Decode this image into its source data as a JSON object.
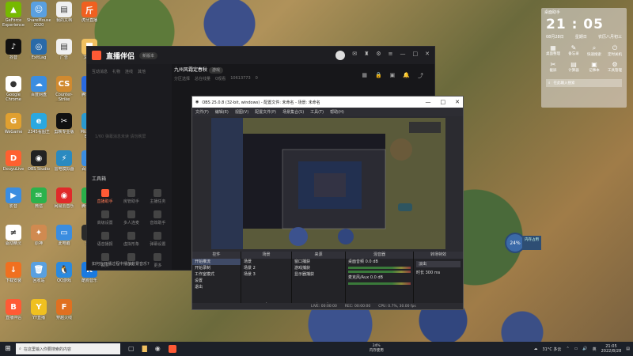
{
  "desktop_icons": [
    {
      "label": "GeForce Experience",
      "color": "#76b900",
      "glyph": "▲"
    },
    {
      "label": "抖音",
      "color": "#111",
      "glyph": "♪"
    },
    {
      "label": "Google Chrome",
      "color": "#fff",
      "glyph": "●"
    },
    {
      "label": "WeGame",
      "color": "#e0a030",
      "glyph": "G"
    },
    {
      "label": "DouyuLive",
      "color": "#ff6030",
      "glyph": "D"
    },
    {
      "label": "影音",
      "color": "#3b8de0",
      "glyph": "▶"
    },
    {
      "label": "驱动精灵",
      "color": "#fff",
      "glyph": "≠"
    },
    {
      "label": "下载安装",
      "color": "#f07020",
      "glyph": "↓"
    },
    {
      "label": "直播伴侣",
      "color": "#ff5a35",
      "glyph": "B"
    },
    {
      "label": "ShareMouse 2020",
      "color": "#5aa0e0",
      "glyph": "☺"
    },
    {
      "label": "ExitLag",
      "color": "#2a6aa8",
      "glyph": "◎"
    },
    {
      "label": "百度网盘",
      "color": "#3b8de0",
      "glyph": "☁"
    },
    {
      "label": "2345看图王",
      "color": "#2aa8e0",
      "glyph": "e"
    },
    {
      "label": "OBS Studio",
      "color": "#222",
      "glyph": "◉"
    },
    {
      "label": "微信",
      "color": "#2bb24c",
      "glyph": "✉"
    },
    {
      "label": "原神",
      "color": "#d08a50",
      "glyph": "✦"
    },
    {
      "label": "回收站",
      "color": "#5aa0e0",
      "glyph": "🗑"
    },
    {
      "label": "YY直播",
      "color": "#f0c020",
      "glyph": "Y"
    },
    {
      "label": "我的文档",
      "color": "#f0f0f0",
      "glyph": "▤"
    },
    {
      "label": "广告",
      "color": "#f0f0f0",
      "glyph": "▤"
    },
    {
      "label": "Counter-Strike Global...",
      "color": "#d08a30",
      "glyph": "CS"
    },
    {
      "label": "剪映专业版",
      "color": "#111",
      "glyph": "✂"
    },
    {
      "label": "雷电模拟器",
      "color": "#2a8ac0",
      "glyph": "⚡"
    },
    {
      "label": "网易云音乐",
      "color": "#e02a2a",
      "glyph": "◉"
    },
    {
      "label": "此电脑",
      "color": "#3b8de0",
      "glyph": "▭"
    },
    {
      "label": "QQ游戏",
      "color": "#2a8ae0",
      "glyph": "🐧"
    },
    {
      "label": "穿越火线",
      "color": "#e07020",
      "glyph": "F"
    },
    {
      "label": "虎牙直播",
      "color": "#f06020",
      "glyph": "斤"
    },
    {
      "label": "文件夹",
      "color": "#f0c060",
      "glyph": "▇"
    },
    {
      "label": "腾讯会议",
      "color": "#2a6ae0",
      "glyph": "▣"
    },
    {
      "label": "Microsoft Edge",
      "color": "#2a9ad0",
      "glyph": "e"
    },
    {
      "label": "百度网盘",
      "color": "#3b8de0",
      "glyph": "☁"
    },
    {
      "label": "腾讯视频",
      "color": "#2ab04a",
      "glyph": "▶"
    },
    {
      "label": "录屏",
      "color": "#2a2a2a",
      "glyph": "◉"
    },
    {
      "label": "酷狗音乐",
      "color": "#1a7ae0",
      "glyph": "K"
    }
  ],
  "stream_app": {
    "logo": "直播伴侣",
    "badge": "新版本",
    "tabs": [
      "互动消息",
      "礼物",
      "连线",
      "其他"
    ],
    "placeholder": "1/60 弹幕消息未读 请勿刷屏",
    "room_title": "九州风霜定春秋",
    "room_tag": "游戏",
    "room_meta": [
      "分区选择",
      "总在线量",
      "0观看",
      "10613773",
      "0"
    ],
    "tools_title": "工具箱",
    "tools": [
      {
        "label": "直播助手",
        "active": true
      },
      {
        "label": "房管助手",
        "active": false
      },
      {
        "label": "主播任务",
        "active": false
      },
      {
        "label": "高级设置",
        "active": false
      },
      {
        "label": "多人连麦",
        "active": false
      },
      {
        "label": "音效助手",
        "active": false
      },
      {
        "label": "语音播报",
        "active": false
      },
      {
        "label": "虚拟形象",
        "active": false
      },
      {
        "label": "弹幕设置",
        "active": false
      },
      {
        "label": "抽奖",
        "active": false
      },
      {
        "label": "PK",
        "active": false
      },
      {
        "label": "更多",
        "active": false
      }
    ],
    "bottom_tip": "如何在开播过程中播放背景音乐?"
  },
  "obs": {
    "title": "OBS 25.0.8 (32-bit, windows) - 配置文件: 未命名 - 场景: 未命名",
    "menu": [
      "文件(F)",
      "编辑(E)",
      "视图(V)",
      "配置文件(P)",
      "场景集合(S)",
      "工具(T)",
      "帮助(H)"
    ],
    "docks": {
      "controls": {
        "title": "控件",
        "items": [
          "开始推流",
          "开始录制",
          "工作室模式",
          "设置",
          "退出"
        ]
      },
      "scenes": {
        "title": "场景",
        "items": [
          "场景",
          "场景 2",
          "场景 3"
        ]
      },
      "sources": {
        "title": "来源",
        "items": [
          "窗口捕获",
          "游戏捕获",
          "显示器捕获"
        ]
      },
      "mixer": {
        "title": "混音器",
        "items": [
          "桌面音频",
          "麦克风/Aux"
        ],
        "db": [
          "0.0 dB",
          "0.0 dB"
        ]
      },
      "transitions": {
        "title": "转场特效",
        "fade": "淡出",
        "duration_label": "时长",
        "duration": "300 ms"
      }
    },
    "status": [
      "LIVE: 00:00:00",
      "REC: 00:00:00",
      "CPU: 0.7%, 30.00 fps"
    ]
  },
  "widget": {
    "title": "桌面助手",
    "time": "21 : 05",
    "date": "08月28日",
    "weekday": "星期日",
    "lunar": "农历八月初三",
    "items": [
      "桌面整理",
      "备忘录",
      "快速搜索",
      "定时关机",
      "截屏",
      "计算器",
      "记事本",
      "工具管理"
    ],
    "search": "在此输入搜索"
  },
  "cpu": {
    "percent": "24%",
    "label": "内存占用"
  },
  "taskbar": {
    "search_placeholder": "在这里输入你要搜索的内容",
    "mem_percent": "24%",
    "mem_label": "内存使用",
    "weather": "31°C 多云",
    "lang": "英",
    "time": "21:05",
    "date": "2022/8/28"
  }
}
